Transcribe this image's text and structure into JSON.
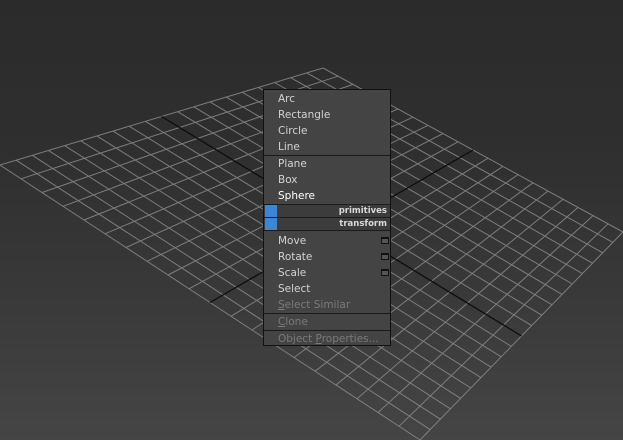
{
  "quad_menu": {
    "group_create_shapes": [
      {
        "label": "Arc",
        "state": "normal"
      },
      {
        "label": "Rectangle",
        "state": "normal"
      },
      {
        "label": "Circle",
        "state": "normal"
      },
      {
        "label": "Line",
        "state": "normal"
      }
    ],
    "group_create_geometry": [
      {
        "label": "Plane",
        "state": "normal"
      },
      {
        "label": "Box",
        "state": "normal"
      },
      {
        "label": "Sphere",
        "state": "highlighted"
      }
    ],
    "quadrant_primitives": "primitives",
    "quadrant_transform": "transform",
    "group_transform": [
      {
        "label": "Move",
        "state": "normal",
        "has_options": true
      },
      {
        "label": "Rotate",
        "state": "normal",
        "has_options": true
      },
      {
        "label": "Scale",
        "state": "normal",
        "has_options": true
      },
      {
        "label": "Select",
        "state": "normal"
      },
      {
        "label": "Select Similar",
        "state": "disabled",
        "underline": "S"
      }
    ],
    "clone": {
      "label": "Clone",
      "state": "disabled",
      "underline": "C"
    },
    "object_properties": {
      "label": "Object Properties...",
      "state": "disabled",
      "underline": "P"
    }
  },
  "colors": {
    "menu_bg": "#444444",
    "quadrant_accent": "#3d86d6",
    "text_normal": "#d2d2d2",
    "text_disabled": "#7a7a7a",
    "text_highlight": "#ffffff"
  },
  "icons": {
    "option_box": "options-box-icon"
  }
}
